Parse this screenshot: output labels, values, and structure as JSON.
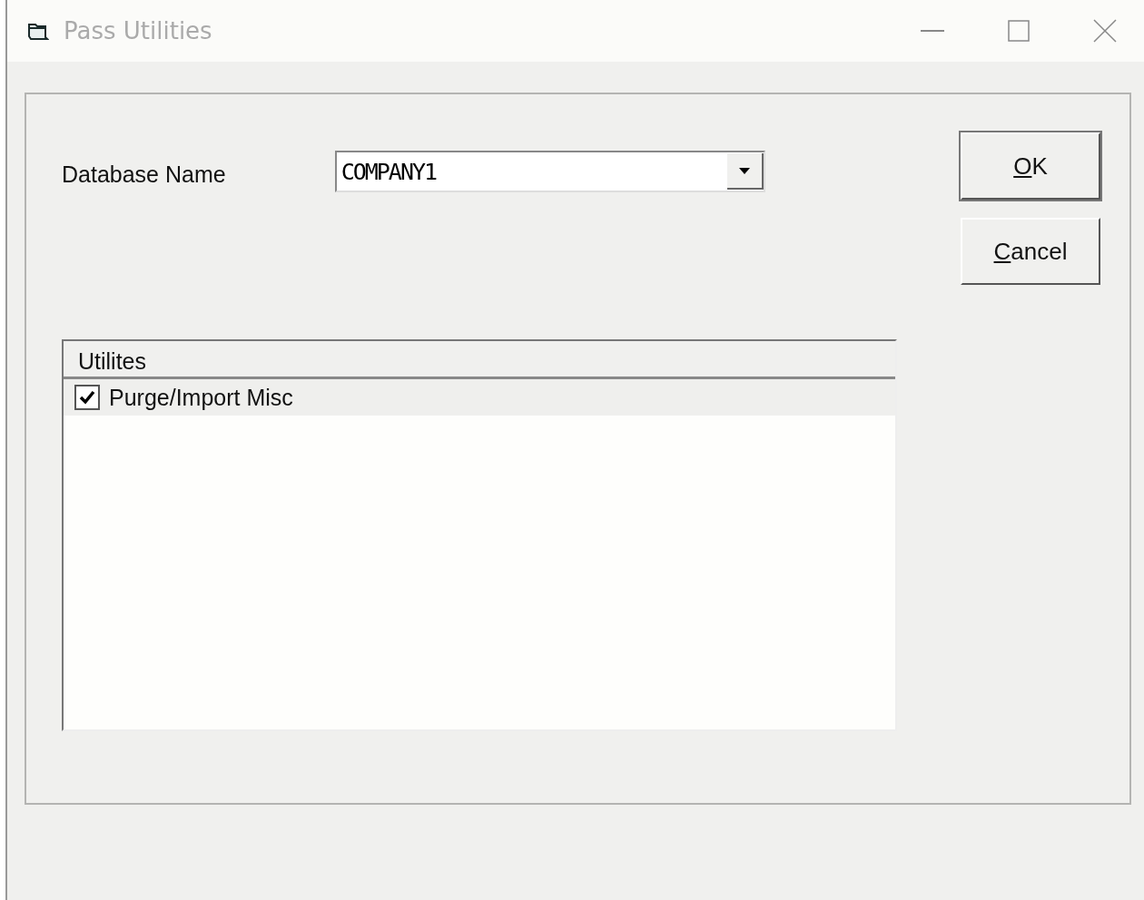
{
  "window": {
    "title": "Pass Utilities"
  },
  "database": {
    "label": "Database Name",
    "value": "COMPANY1"
  },
  "buttons": [
    {
      "label": "OK",
      "default": true
    },
    {
      "label": "Cancel",
      "default": false
    }
  ],
  "utilities": {
    "column": "Utilites",
    "items": [
      {
        "label": "Purge/Import Misc",
        "checked": true,
        "selected": true
      }
    ]
  }
}
